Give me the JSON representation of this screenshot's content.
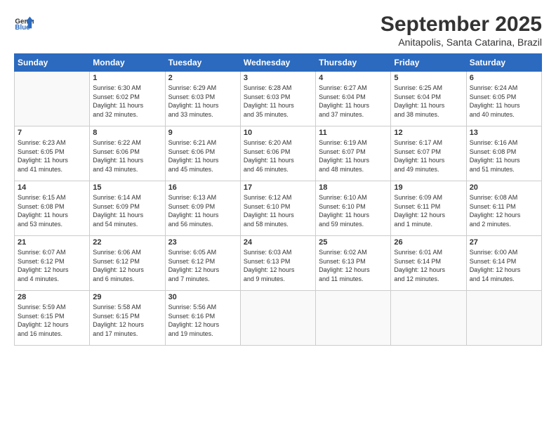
{
  "header": {
    "logo_line1": "General",
    "logo_line2": "Blue",
    "month": "September 2025",
    "location": "Anitapolis, Santa Catarina, Brazil"
  },
  "weekdays": [
    "Sunday",
    "Monday",
    "Tuesday",
    "Wednesday",
    "Thursday",
    "Friday",
    "Saturday"
  ],
  "weeks": [
    [
      {
        "num": "",
        "info": ""
      },
      {
        "num": "1",
        "info": "Sunrise: 6:30 AM\nSunset: 6:02 PM\nDaylight: 11 hours\nand 32 minutes."
      },
      {
        "num": "2",
        "info": "Sunrise: 6:29 AM\nSunset: 6:03 PM\nDaylight: 11 hours\nand 33 minutes."
      },
      {
        "num": "3",
        "info": "Sunrise: 6:28 AM\nSunset: 6:03 PM\nDaylight: 11 hours\nand 35 minutes."
      },
      {
        "num": "4",
        "info": "Sunrise: 6:27 AM\nSunset: 6:04 PM\nDaylight: 11 hours\nand 37 minutes."
      },
      {
        "num": "5",
        "info": "Sunrise: 6:25 AM\nSunset: 6:04 PM\nDaylight: 11 hours\nand 38 minutes."
      },
      {
        "num": "6",
        "info": "Sunrise: 6:24 AM\nSunset: 6:05 PM\nDaylight: 11 hours\nand 40 minutes."
      }
    ],
    [
      {
        "num": "7",
        "info": "Sunrise: 6:23 AM\nSunset: 6:05 PM\nDaylight: 11 hours\nand 41 minutes."
      },
      {
        "num": "8",
        "info": "Sunrise: 6:22 AM\nSunset: 6:06 PM\nDaylight: 11 hours\nand 43 minutes."
      },
      {
        "num": "9",
        "info": "Sunrise: 6:21 AM\nSunset: 6:06 PM\nDaylight: 11 hours\nand 45 minutes."
      },
      {
        "num": "10",
        "info": "Sunrise: 6:20 AM\nSunset: 6:06 PM\nDaylight: 11 hours\nand 46 minutes."
      },
      {
        "num": "11",
        "info": "Sunrise: 6:19 AM\nSunset: 6:07 PM\nDaylight: 11 hours\nand 48 minutes."
      },
      {
        "num": "12",
        "info": "Sunrise: 6:17 AM\nSunset: 6:07 PM\nDaylight: 11 hours\nand 49 minutes."
      },
      {
        "num": "13",
        "info": "Sunrise: 6:16 AM\nSunset: 6:08 PM\nDaylight: 11 hours\nand 51 minutes."
      }
    ],
    [
      {
        "num": "14",
        "info": "Sunrise: 6:15 AM\nSunset: 6:08 PM\nDaylight: 11 hours\nand 53 minutes."
      },
      {
        "num": "15",
        "info": "Sunrise: 6:14 AM\nSunset: 6:09 PM\nDaylight: 11 hours\nand 54 minutes."
      },
      {
        "num": "16",
        "info": "Sunrise: 6:13 AM\nSunset: 6:09 PM\nDaylight: 11 hours\nand 56 minutes."
      },
      {
        "num": "17",
        "info": "Sunrise: 6:12 AM\nSunset: 6:10 PM\nDaylight: 11 hours\nand 58 minutes."
      },
      {
        "num": "18",
        "info": "Sunrise: 6:10 AM\nSunset: 6:10 PM\nDaylight: 11 hours\nand 59 minutes."
      },
      {
        "num": "19",
        "info": "Sunrise: 6:09 AM\nSunset: 6:11 PM\nDaylight: 12 hours\nand 1 minute."
      },
      {
        "num": "20",
        "info": "Sunrise: 6:08 AM\nSunset: 6:11 PM\nDaylight: 12 hours\nand 2 minutes."
      }
    ],
    [
      {
        "num": "21",
        "info": "Sunrise: 6:07 AM\nSunset: 6:12 PM\nDaylight: 12 hours\nand 4 minutes."
      },
      {
        "num": "22",
        "info": "Sunrise: 6:06 AM\nSunset: 6:12 PM\nDaylight: 12 hours\nand 6 minutes."
      },
      {
        "num": "23",
        "info": "Sunrise: 6:05 AM\nSunset: 6:12 PM\nDaylight: 12 hours\nand 7 minutes."
      },
      {
        "num": "24",
        "info": "Sunrise: 6:03 AM\nSunset: 6:13 PM\nDaylight: 12 hours\nand 9 minutes."
      },
      {
        "num": "25",
        "info": "Sunrise: 6:02 AM\nSunset: 6:13 PM\nDaylight: 12 hours\nand 11 minutes."
      },
      {
        "num": "26",
        "info": "Sunrise: 6:01 AM\nSunset: 6:14 PM\nDaylight: 12 hours\nand 12 minutes."
      },
      {
        "num": "27",
        "info": "Sunrise: 6:00 AM\nSunset: 6:14 PM\nDaylight: 12 hours\nand 14 minutes."
      }
    ],
    [
      {
        "num": "28",
        "info": "Sunrise: 5:59 AM\nSunset: 6:15 PM\nDaylight: 12 hours\nand 16 minutes."
      },
      {
        "num": "29",
        "info": "Sunrise: 5:58 AM\nSunset: 6:15 PM\nDaylight: 12 hours\nand 17 minutes."
      },
      {
        "num": "30",
        "info": "Sunrise: 5:56 AM\nSunset: 6:16 PM\nDaylight: 12 hours\nand 19 minutes."
      },
      {
        "num": "",
        "info": ""
      },
      {
        "num": "",
        "info": ""
      },
      {
        "num": "",
        "info": ""
      },
      {
        "num": "",
        "info": ""
      }
    ]
  ]
}
